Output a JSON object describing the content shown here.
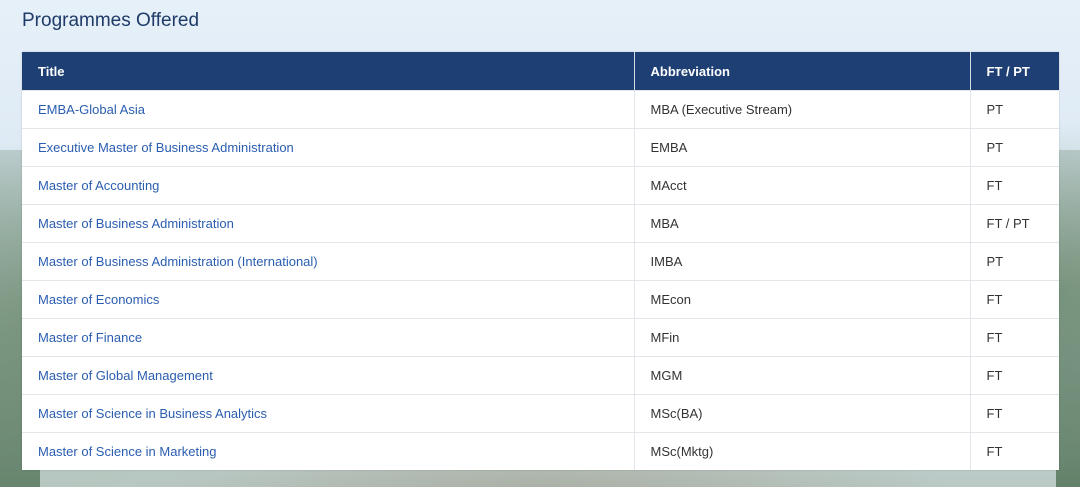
{
  "page": {
    "heading": "Programmes Offered"
  },
  "table": {
    "headers": {
      "title": "Title",
      "abbreviation": "Abbreviation",
      "mode": "FT / PT"
    },
    "rows": [
      {
        "title": "EMBA-Global Asia",
        "abbreviation": "MBA (Executive Stream)",
        "mode": "PT"
      },
      {
        "title": "Executive Master of Business Administration",
        "abbreviation": "EMBA",
        "mode": "PT"
      },
      {
        "title": "Master of Accounting",
        "abbreviation": "MAcct",
        "mode": "FT"
      },
      {
        "title": "Master of Business Administration",
        "abbreviation": "MBA",
        "mode": "FT / PT"
      },
      {
        "title": "Master of Business Administration (International)",
        "abbreviation": "IMBA",
        "mode": "PT"
      },
      {
        "title": "Master of Economics",
        "abbreviation": "MEcon",
        "mode": "FT"
      },
      {
        "title": "Master of Finance",
        "abbreviation": "MFin",
        "mode": "FT"
      },
      {
        "title": "Master of Global Management",
        "abbreviation": "MGM",
        "mode": "FT"
      },
      {
        "title": "Master of Science in Business Analytics",
        "abbreviation": "MSc(BA)",
        "mode": "FT"
      },
      {
        "title": "Master of Science in Marketing",
        "abbreviation": "MSc(Mktg)",
        "mode": "FT"
      }
    ]
  },
  "colors": {
    "header_bg": "#1e3f74",
    "link": "#2a5db0",
    "heading": "#1f3b68"
  }
}
